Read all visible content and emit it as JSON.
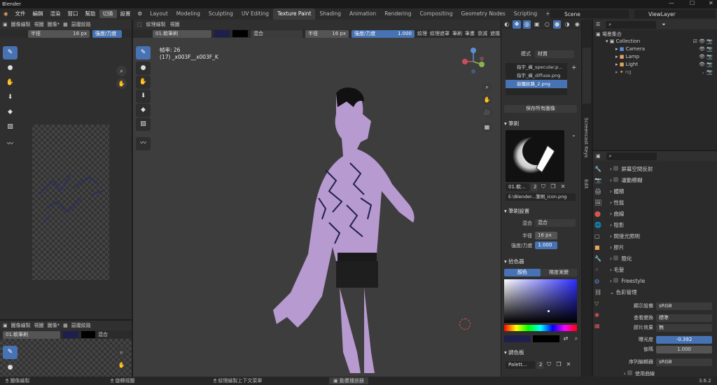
{
  "window": {
    "title": "Blender",
    "controls": [
      "—",
      "☐",
      "✕"
    ]
  },
  "menu": {
    "items": [
      "文件",
      "編輯",
      "渲染",
      "窗口",
      "幫助"
    ],
    "mode_button": "切換",
    "extra": "設置"
  },
  "workspaces": [
    "Layout",
    "Modeling",
    "Sculpting",
    "UV Editing",
    "Texture Paint",
    "Shading",
    "Animation",
    "Rendering",
    "Compositing",
    "Geometry Nodes",
    "Scripting"
  ],
  "active_workspace": "Texture Paint",
  "scene": {
    "label": "Scene",
    "viewlayer": "ViewLayer"
  },
  "image_editor": {
    "mode": "圖像繪製",
    "view": "視圖",
    "image": "圖像*",
    "image_name": "惡魔紋路",
    "radius_label": "半徑",
    "radius_value": "16 px",
    "strength_label": "強度/力度"
  },
  "viewport": {
    "mode": "紋理繪製",
    "view": "視圖",
    "brush": "01.軟筆刷",
    "blend": "混合",
    "radius_label": "半徑",
    "radius_value": "16 px",
    "strength_label": "強度/力度",
    "strength_value": "1.000",
    "menus": [
      "紋理",
      "紋理遮罩",
      "筆刷",
      "筆畫",
      "衰減",
      "遮擋"
    ],
    "overlay_line1": "幀率: 26",
    "overlay_line2": "(17) _x003F__x003F_K"
  },
  "bottom_editor": {
    "mode": "圖像繪製",
    "view": "視圖",
    "image": "圖像*",
    "image_name": "惡魔紋路",
    "brush": "01.軟筆刷",
    "blend": "混合"
  },
  "tool_panel": {
    "mode_label": "模式",
    "mode_value": "材質",
    "textures": [
      "指宇_褲_specular.p...",
      "指宇_褲_diffuse.png",
      "惡魔紋路_2.png"
    ],
    "save_all": "保存所有圖像",
    "brush_section": "筆刷",
    "brush_name": "01.軟...",
    "brush_users": "2",
    "brush_path": "E:\\Blender...筆刷_icon.png",
    "brush_settings": "筆刷設置",
    "blend_label": "混合",
    "blend_value": "混合",
    "radius_label": "半徑",
    "radius_value": "16 px",
    "strength_label": "強度/力度",
    "strength_value": "1.000",
    "color_picker": "拾色器",
    "tab_color": "顏色",
    "tab_gradient": "梯度漸變",
    "palette_section": "調色板",
    "palette_name": "Palett...",
    "palette_users": "2"
  },
  "side_tabs": [
    "Screencast Keys",
    "Edit"
  ],
  "outliner": {
    "title": "場景集合",
    "items": [
      {
        "name": "Collection",
        "color": "#ddd"
      },
      {
        "name": "Camera",
        "color": "#ddd"
      },
      {
        "name": "Lamp",
        "color": "#ddd"
      },
      {
        "name": "Light",
        "color": "#ddd"
      },
      {
        "name": "ng",
        "color": "#888"
      }
    ]
  },
  "properties": {
    "sections": [
      "屏幕空間反射",
      "運動模糊",
      "體積",
      "性能",
      "曲線",
      "陰影",
      "間接光照明",
      "膠片",
      "簡化",
      "毛髮",
      "Freestyle"
    ],
    "color_management": "色彩管理",
    "display_label": "顯示設備",
    "display_value": "sRGB",
    "view_label": "查看變換",
    "view_value": "標準",
    "look_label": "膠片效果",
    "look_value": "無",
    "exposure_label": "曝光度",
    "exposure_value": "-0.392",
    "gamma_label": "伽瑪",
    "gamma_value": "1.000",
    "sequencer_label": "序列編輯器",
    "sequencer_value": "sRGB",
    "curves": "使用曲線"
  },
  "statusbar": {
    "item1": "圖像繪製",
    "item2": "旋轉視圖",
    "item3": "紋理繪製上下文菜單",
    "item4": "動畫播放器",
    "version": "3.6.2"
  },
  "colors": {
    "accent": "#4772b3",
    "skin": "#b79ad0",
    "bg": "#3d3d3d"
  }
}
